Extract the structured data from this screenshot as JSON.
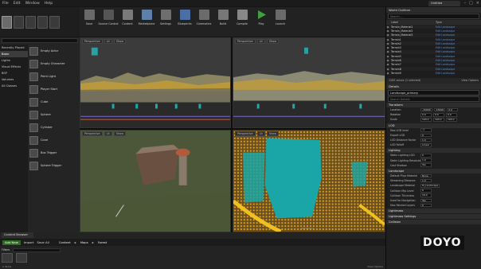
{
  "menu": [
    "File",
    "Edit",
    "Window",
    "Help"
  ],
  "document_tab": "Untitled",
  "window_controls": [
    "minimize-icon",
    "maximize-icon",
    "close-icon"
  ],
  "toolbar": [
    "Save",
    "Source Control",
    "Content",
    "Marketplace",
    "Settings",
    "Blueprints",
    "Cinematics",
    "Build",
    "Compile",
    "Play",
    "Launch"
  ],
  "place_mode": {
    "categories": [
      "Recently Placed",
      "Basic",
      "Lights",
      "Visual Effects",
      "BSP",
      "Volumes",
      "All Classes"
    ],
    "active_category": "Basic",
    "items": [
      "Empty Actor",
      "Empty Character",
      "Point Light",
      "Player Start",
      "Cube",
      "Sphere",
      "Cylinder",
      "Cone",
      "Box Trigger",
      "Sphere Trigger"
    ]
  },
  "viewports": {
    "buttons": [
      "Perspective",
      "Lit",
      "Show"
    ],
    "label": "Wireframe"
  },
  "outliner": {
    "tab": "World Outliner",
    "search_placeholder": "Search...",
    "columns": [
      "Label",
      "Type"
    ],
    "rows": [
      {
        "label": "Terrain_Material1",
        "type": "Edit Landscape"
      },
      {
        "label": "Terrain_Material2",
        "type": "Edit Landscape"
      },
      {
        "label": "Terrain_Material3",
        "type": "Edit Landscape"
      },
      {
        "label": "Terrain1",
        "type": "Edit Landscape"
      },
      {
        "label": "Terrain2",
        "type": "Edit Landscape"
      },
      {
        "label": "Terrain3",
        "type": "Edit Landscape"
      },
      {
        "label": "Terrain4",
        "type": "Edit Landscape"
      },
      {
        "label": "Terrain5",
        "type": "Edit Landscape"
      },
      {
        "label": "Terrain6",
        "type": "Edit Landscape"
      },
      {
        "label": "Terrain7",
        "type": "Edit Landscape"
      },
      {
        "label": "Terrain8",
        "type": "Edit Landscape"
      },
      {
        "label": "Terrain9",
        "type": "Edit Landscape"
      }
    ],
    "status": "1283 actors (1 selected)",
    "view_options": "View Options"
  },
  "details": {
    "tab": "Details",
    "search_placeholder": "Search Details",
    "name": "Landscape_primary",
    "sections": [
      {
        "title": "Transform",
        "props": [
          {
            "label": "Location",
            "values": [
              "-15000",
              "-15000",
              "0.0"
            ]
          },
          {
            "label": "Rotation",
            "values": [
              "0.0",
              "0.0",
              "0.0"
            ]
          },
          {
            "label": "Scale",
            "values": [
              "100.0",
              "100.0",
              "100.0"
            ]
          }
        ]
      },
      {
        "title": "LOD",
        "props": [
          {
            "label": "Max LOD level",
            "values": [
              "-1"
            ]
          },
          {
            "label": "Export LOD",
            "values": [
              "0"
            ]
          },
          {
            "label": "LOD Distance Factor",
            "values": [
              "1.0"
            ]
          },
          {
            "label": "LOD Falloff",
            "values": [
              "Linear"
            ]
          }
        ]
      },
      {
        "title": "Lighting",
        "props": [
          {
            "label": "Static Lighting LOD",
            "values": [
              "0"
            ]
          },
          {
            "label": "Static Lighting Resolution",
            "values": [
              "1.0"
            ]
          },
          {
            "label": "Cast Shadow",
            "values": [
              "Yes"
            ]
          }
        ]
      },
      {
        "title": "Landscape",
        "props": [
          {
            "label": "Default Phys Material",
            "values": [
              "None"
            ]
          },
          {
            "label": "Streaming Distance",
            "values": [
              "1.0"
            ]
          },
          {
            "label": "Landscape Material",
            "values": [
              "M_Landscape"
            ]
          },
          {
            "label": "Collision Mip Level",
            "values": [
              "0"
            ]
          },
          {
            "label": "Collision Thickness",
            "values": [
              "16.0"
            ]
          },
          {
            "label": "Used for Navigation",
            "values": [
              "Yes"
            ]
          },
          {
            "label": "Max Painted Layers",
            "values": [
              "0"
            ]
          }
        ]
      },
      {
        "title": "Lightmass",
        "props": []
      },
      {
        "title": "Lightmass Settings",
        "props": []
      },
      {
        "title": "Collision",
        "props": []
      }
    ]
  },
  "content_browser": {
    "tab": "Content Browser",
    "add_new": "Add New",
    "import": "Import",
    "save_all": "Save All",
    "path": [
      "Content",
      "Maps",
      "Forest"
    ],
    "filters": "Filters",
    "search_placeholder": "Search Forest",
    "item_count": "2 items",
    "view_options": "View Options"
  },
  "watermark": "DOYO"
}
